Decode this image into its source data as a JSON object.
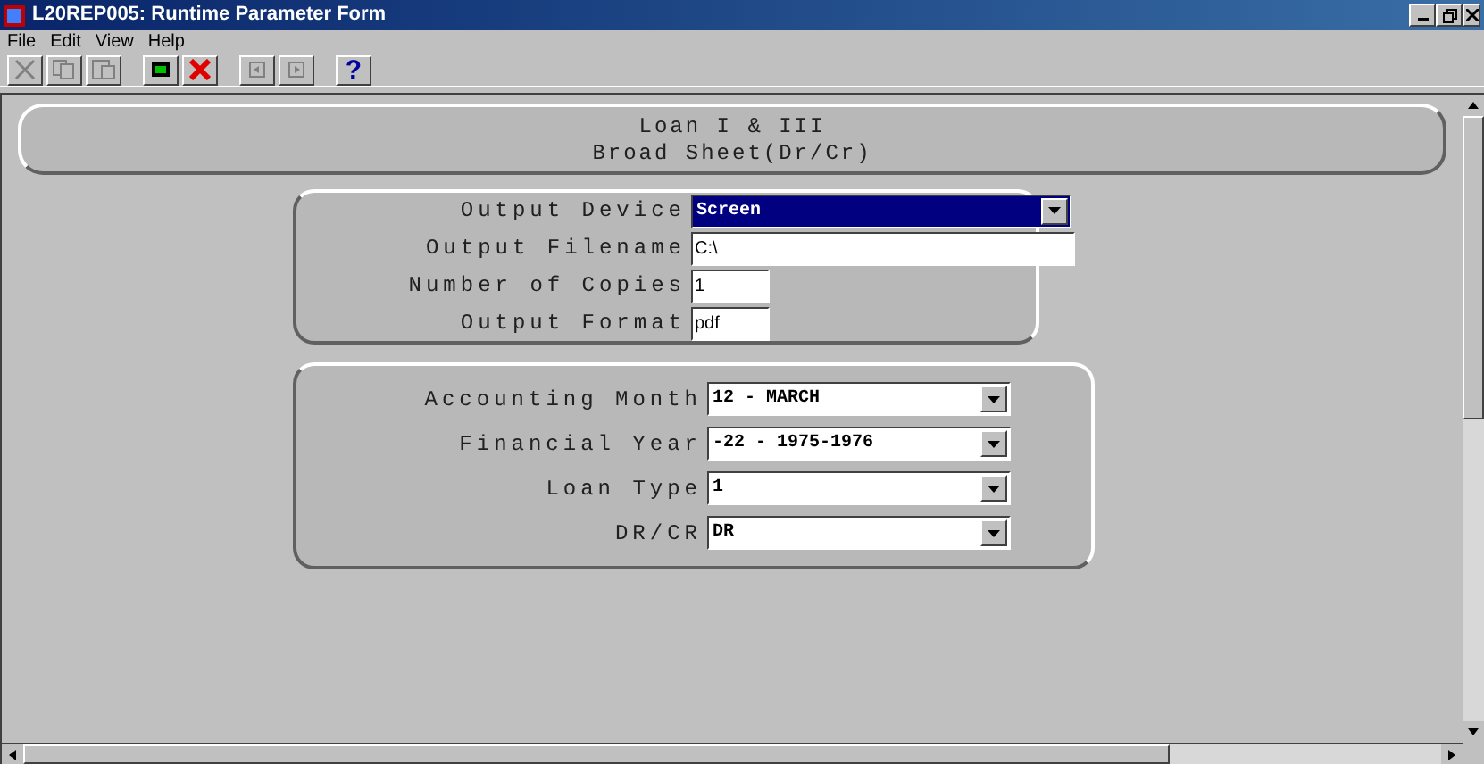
{
  "window": {
    "title": "L20REP005: Runtime Parameter Form"
  },
  "menu": [
    "File",
    "Edit",
    "View",
    "Help"
  ],
  "toolbar": [
    {
      "kind": "cut",
      "disabled": true
    },
    {
      "kind": "copy",
      "disabled": true
    },
    {
      "kind": "paste",
      "disabled": true
    },
    {
      "kind": "run",
      "disabled": false
    },
    {
      "kind": "cancel",
      "disabled": false
    },
    {
      "kind": "previous",
      "disabled": true
    },
    {
      "kind": "next",
      "disabled": true
    },
    {
      "kind": "help",
      "label": "?",
      "disabled": false
    }
  ],
  "header": {
    "title": "Loan I & III",
    "subtitle": "Broad Sheet(Dr/Cr)"
  },
  "output_fields": [
    {
      "label": "Output Device",
      "value": "Screen",
      "kind": "dropdown",
      "highlighted": true
    },
    {
      "label": "Output Filename",
      "value": "C:\\",
      "kind": "text",
      "highlighted": false
    },
    {
      "label": "Number of Copies",
      "value": "1",
      "kind": "short",
      "highlighted": false
    },
    {
      "label": "Output Format",
      "value": "pdf",
      "kind": "short",
      "highlighted": false
    }
  ],
  "parameter_fields": [
    {
      "label": "Accounting Month",
      "value": "12 - MARCH",
      "kind": "dropdown"
    },
    {
      "label": "Financial Year",
      "value": "-22 - 1975-1976",
      "kind": "dropdown"
    },
    {
      "label": "Loan Type",
      "value": "1",
      "kind": "dropdown"
    },
    {
      "label": "DR/CR",
      "value": "DR",
      "kind": "dropdown"
    }
  ]
}
